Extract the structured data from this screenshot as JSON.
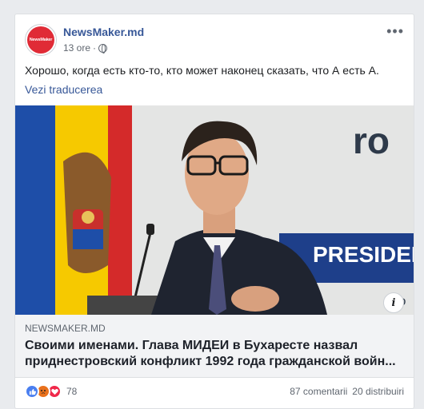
{
  "post": {
    "page_name": "NewsMaker.md",
    "avatar_text": "NewsMaker",
    "time": "13 ore",
    "separator": "·",
    "more": "•••",
    "text": "Хорошо, когда есть кто-то, кто может наконец сказать, что А есть А.",
    "translate": "Vezi traducerea"
  },
  "image": {
    "backdrop_text_1": "ro",
    "backdrop_text_2": "PRESIDEN",
    "backdrop_text_3": "Co"
  },
  "link": {
    "domain": "NEWSMAKER.MD",
    "headline": "Своими именами. Глава МИДЕИ в Бухаресте назвал приднестровский конфликт 1992 года гражданской войн...",
    "info": "i"
  },
  "stats": {
    "reaction_count": "78",
    "comments": "87 comentarii",
    "shares": "20 distribuiri"
  },
  "colors": {
    "link": "#385898",
    "brand_red": "#e02b36",
    "like": "#4a7ff0",
    "angry": "#e9711c",
    "love": "#f0284a"
  }
}
